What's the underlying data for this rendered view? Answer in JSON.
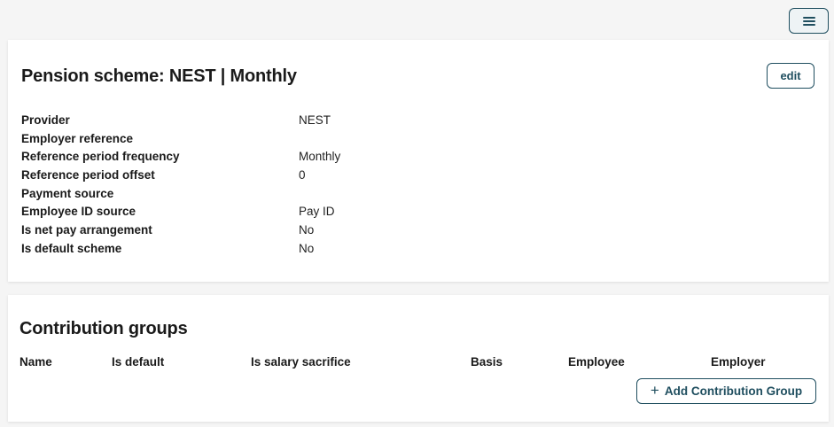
{
  "header": {
    "menu_icon": "hamburger-menu-icon"
  },
  "scheme": {
    "title": "Pension scheme: NEST | Monthly",
    "edit_label": "edit",
    "properties": [
      {
        "label": "Provider",
        "value": "NEST"
      },
      {
        "label": "Employer reference",
        "value": ""
      },
      {
        "label": "Reference period frequency",
        "value": "Monthly"
      },
      {
        "label": "Reference period offset",
        "value": "0"
      },
      {
        "label": "Payment source",
        "value": ""
      },
      {
        "label": "Employee ID source",
        "value": "Pay ID"
      },
      {
        "label": "Is net pay arrangement",
        "value": "No"
      },
      {
        "label": "Is default scheme",
        "value": "No"
      }
    ]
  },
  "contribution_groups": {
    "title": "Contribution groups",
    "columns": [
      "Name",
      "Is default",
      "Is salary sacrifice",
      "Basis",
      "Employee",
      "Employer"
    ],
    "add_label": "Add Contribution Group",
    "add_icon": "plus-icon"
  },
  "colors": {
    "accent": "#1f4e5f",
    "background": "#f5f5f5",
    "card": "#ffffff"
  }
}
